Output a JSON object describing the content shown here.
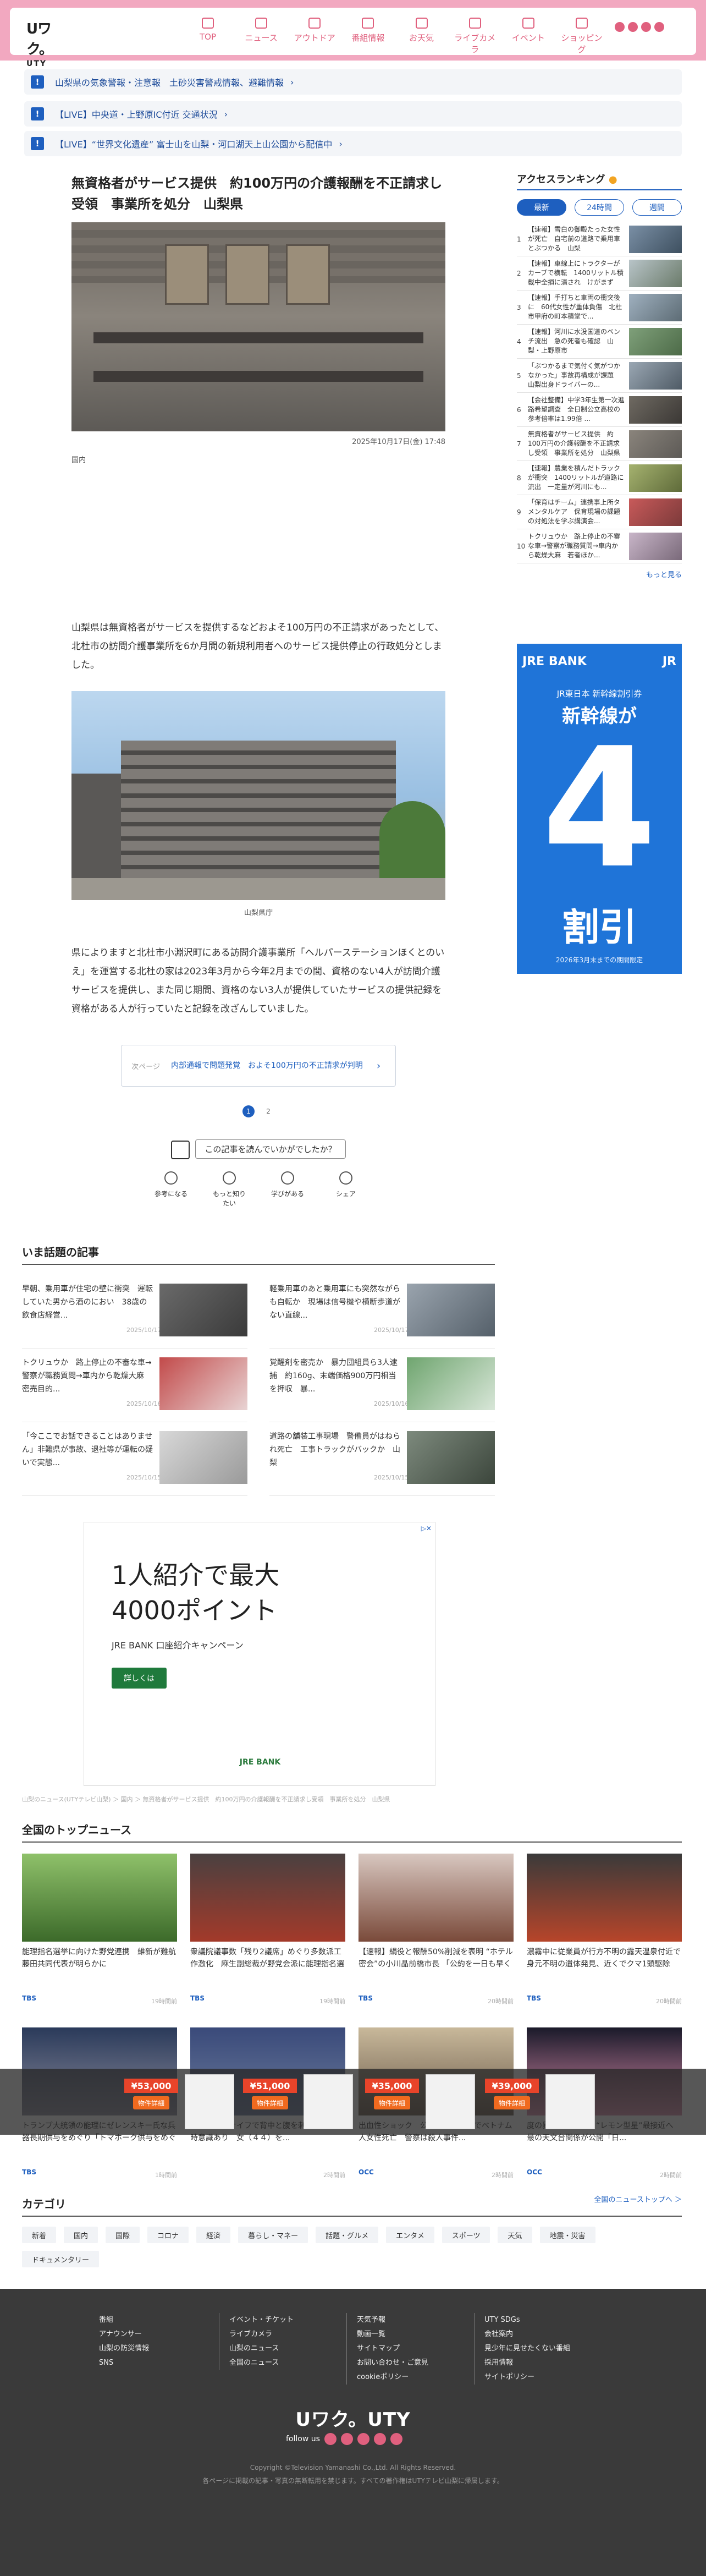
{
  "header": {
    "logo_main": "Uワク。",
    "logo_sub": "UTY",
    "nav": [
      "TOP",
      "ニュース",
      "アウトドア",
      "番組情報",
      "お天気",
      "ライブカメラ",
      "イベント",
      "ショッピング"
    ]
  },
  "alerts": [
    {
      "text": "山梨県の気象警報・注意報　土砂災害警戒情報、避難情報"
    },
    {
      "text": "【LIVE】中央道・上野原IC付近 交通状況"
    },
    {
      "text": "【LIVE】“世界文化遺産” 富士山を山梨・河口湖天上山公園から配信中"
    }
  ],
  "article": {
    "headline": "無資格者がサービス提供　約100万円の介護報酬を不正請求し受領　事業所を処分　山梨県",
    "date": "2025年10月17日(金) 17:48",
    "credit": "国内",
    "para1": "山梨県は無資格者がサービスを提供するなどおよそ100万円の不正請求があったとして、北杜市の訪問介護事業所を6か月間の新規利用者へのサービス提供停止の行政処分としました。",
    "photo2_caption": "山梨県庁",
    "para2": "県によりますと北杜市小淵沢町にある訪問介護事業所「ヘルパーステーションほくとのいえ」を運営する北杜の家は2023年3月から今年2月までの間、資格のない4人が訪問介護サービスを提供し、また同じ期間、資格のない3人が提供していたサービスの提供記録を資格がある人が行っていたと記録を改ざんしていました。",
    "related_label": "次ページ",
    "related_title": "内部通報で問題発覚　およそ100万円の不正請求が判明",
    "pages": [
      "1",
      "2"
    ],
    "reaction_q": "この記事を読んでいかがでしたか？",
    "reactions": [
      "参考になる",
      "もっと知りたい",
      "学びがある",
      "シェア"
    ]
  },
  "ranking": {
    "title": "アクセスランキング",
    "tabs": [
      "最新",
      "24時間",
      "週間"
    ],
    "items": [
      {
        "num": "1",
        "text": "【速報】雪白の御殿たった女性が死亡　自宅前の道路で乗用車とぶつかる　山梨"
      },
      {
        "num": "2",
        "text": "【速報】車線上にトラクターがカーブで横転　1400リットル積載中全損に潰され　けがまずに..."
      },
      {
        "num": "3",
        "text": "【速報】手打ちと車両の衝突後に　60代女性が重体負傷　北杜市甲府の町本積堂で..."
      },
      {
        "num": "4",
        "text": "【速報】河川に水没国道のベンチ流出　急の死者も確認　山梨・上野原市"
      },
      {
        "num": "5",
        "text": "「ぶつかるまで気付く気がつかなかった」事故再構成が課題　山梨出身ドライバーの..."
      },
      {
        "num": "6",
        "text": "【会社整備】中学3年生第一次進路希望調査　全日制公立高校の参考倍率は1.99倍 ..."
      },
      {
        "num": "7",
        "text": "無資格者がサービス提供　約100万円の介護報酬を不正請求し受領　事業所を処分　山梨県"
      },
      {
        "num": "8",
        "text": "【速報】農業を積んだトラックが衝突　1400リットルが道路に流出　一定量が河川にも..."
      },
      {
        "num": "9",
        "text": "「保育はチーム」連携事上所タメンタルケア　保育現場の課題の対処法を学ぶ講演会..."
      },
      {
        "num": "10",
        "text": "トクリュウか　路上停止の不審な車→警察が職務質問→車内から乾燥大麻　若者ほか..."
      }
    ],
    "more": "もっと見る"
  },
  "side_ad": {
    "brand": "JRE BANK",
    "jr": "JR",
    "line1": "JR東日本 新幹線割引券",
    "line2": "新幹線が",
    "big": "4",
    "line3": "割引",
    "note": "2026年3月末までの期間限定"
  },
  "trending": {
    "title": "いま話題の記事",
    "items": [
      {
        "text": "早朝、乗用車が住宅の壁に衝突　運転していた男から酒のにおい　38歳の飲食店経営...",
        "date": "2025/10/17"
      },
      {
        "text": "軽乗用車のあと乗用車にも突然ながらも自転か　現場は信号機や横断歩道がない直線...",
        "date": "2025/10/17"
      },
      {
        "text": "トクリュウか　路上停止の不審な車→警察が職務質問→車内から乾燥大麻　密売目的...",
        "date": "2025/10/16"
      },
      {
        "text": "覚醒剤を密売か　暴力団組員ら3人逮捕　約160g、末端価格900万円相当を押収　暴...",
        "date": "2025/10/16"
      },
      {
        "text": "「今ここでお話できることはありません」非難県が事故、退社等が運転の疑いで実態...",
        "date": "2025/10/15"
      },
      {
        "text": "道路の舗装工事現場　警備員がはねられ死亡　工事トラックがバックか　山梨",
        "date": "2025/10/15"
      }
    ]
  },
  "ad_bottom": {
    "line1": "1人紹介で最大",
    "line2": "4000ポイント",
    "line3": "JRE BANK 口座紹介キャンペーン",
    "button": "詳しくは",
    "brand": "JRE BANK"
  },
  "breadcrumb": "山梨のニュース(UTYテレビ山梨) ＞ 国内 ＞ 無資格者がサービス提供　約100万円の介護報酬を不正請求し受領　事業所を処分　山梨県",
  "topnews": {
    "title": "全国のトップニュース",
    "cards": [
      {
        "title": "能理指名選挙に向けた野党連携　維新が難航　藤田共同代表が明らかに",
        "src": "TBS",
        "time": "19時間前"
      },
      {
        "title": "衆議院議事数「残り2議席」めぐり多数派工作激化　麻生副総裁が野党会派に能理指名選挙で「高市早苗」と書く...",
        "src": "TBS",
        "time": "19時間前"
      },
      {
        "title": "【速報】絹役と報酬50%削減を表明 “ホテル密会”の小川晶前橋市長 「公約を一日も早く果たしてほしい...",
        "src": "TBS",
        "time": "20時間前"
      },
      {
        "title": "濃霧中に従業員が行方不明の露天温泉付近で身元不明の遺体発見、近くでクマ1頭駆除　震災発生に出動...",
        "src": "TBS",
        "time": "20時間前"
      },
      {
        "title": "トランプ大統領の能理にゼレンスキー氏な兵器長期供与をめぐり「トマホーク供与をめぐり...",
        "src": "TBS",
        "time": "1時間前"
      },
      {
        "title": "（５８）がナイフで背中と腹を刺され　搬送時意識あり　女（４４）を...",
        "src": "",
        "time": "2時間前"
      },
      {
        "title": "出血性ショック　公安任務の一室でベトナム人女性死亡　警察は殺人事件...",
        "src": "OCC",
        "time": "2時間前"
      },
      {
        "title": "度の暴き」顔に光る“レモン型星”最接近へ　最の天文台関係が公開「日...",
        "src": "OCC",
        "time": "2時間前"
      }
    ],
    "more": "全国のニューストップへ ＞"
  },
  "overlay_ads": [
    {
      "price": "¥53,000",
      "detail": "物件詳細"
    },
    {
      "price": "¥51,000",
      "detail": "物件詳細"
    },
    {
      "price": "¥35,000",
      "detail": "物件詳細"
    },
    {
      "price": "¥39,000",
      "detail": "物件詳細"
    }
  ],
  "category": {
    "title": "カテゴリ",
    "items": [
      "新着",
      "国内",
      "国際",
      "コロナ",
      "経済",
      "暮らし・マネー",
      "話題・グルメ",
      "エンタメ",
      "スポーツ",
      "天気",
      "地震・災害",
      "ドキュメンタリー"
    ]
  },
  "footer": {
    "col1": [
      "番組",
      "アナウンサー",
      "山梨の防災情報",
      "SNS"
    ],
    "col2": [
      "イベント・チケット",
      "ライブカメラ",
      "山梨のニュース",
      "全国のニュース"
    ],
    "col3": [
      "天気予報",
      "動画一覧",
      "サイトマップ",
      "お問い合わせ・ご意見",
      "cookieポリシー"
    ],
    "col4": [
      "UTY SDGs",
      "会社案内",
      "見少年に見せたくない番組",
      "採用情報",
      "サイトポリシー"
    ],
    "logo": "Uワク。UTY",
    "follow": "follow us",
    "copyright": "Copyright ©Television Yamanashi Co.,Ltd. All Rights Reserved.",
    "note": "各ページに掲載の記事・写真の無断転用を禁じます。すべての著作権はUTYテレビ山梨に帰属します。"
  }
}
